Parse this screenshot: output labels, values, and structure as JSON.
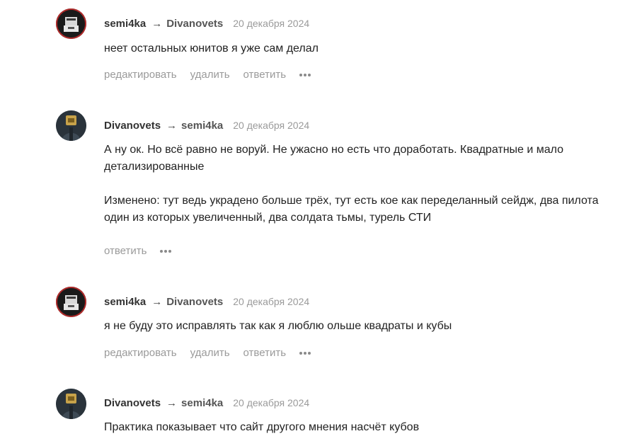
{
  "comments": [
    {
      "author": "semi4ka",
      "arrow": "→",
      "reply_to": "Divanovets",
      "date": "20 декабря 2024",
      "text": [
        "неет остальных юнитов я уже сам делал"
      ],
      "actions": [
        "редактировать",
        "удалить",
        "ответить"
      ],
      "avatar_icon": "robot-avatar-icon"
    },
    {
      "author": "Divanovets",
      "arrow": "→",
      "reply_to": "semi4ka",
      "date": "20 декабря 2024",
      "text": [
        "А ну ок. Но всё равно не воруй. Не ужасно но есть что доработать. Квадратные и мало детализированные",
        "Изменено: тут ведь украдено больше трёх, тут есть кое как переделанный сейдж, два пилота один из которых увеличенный, два солдата тьмы, турель СТИ"
      ],
      "actions": [
        "ответить"
      ],
      "avatar_icon": "person-avatar-icon"
    },
    {
      "author": "semi4ka",
      "arrow": "→",
      "reply_to": "Divanovets",
      "date": "20 декабря 2024",
      "text": [
        "я не буду это исправлять так как я люблю ольше квадраты и кубы"
      ],
      "actions": [
        "редактировать",
        "удалить",
        "ответить"
      ],
      "avatar_icon": "robot-avatar-icon"
    },
    {
      "author": "Divanovets",
      "arrow": "→",
      "reply_to": "semi4ka",
      "date": "20 декабря 2024",
      "text": [
        "Практика показывает что сайт другого мнения насчёт кубов"
      ],
      "actions": [],
      "avatar_icon": "person-avatar-icon"
    }
  ],
  "colors": {
    "text": "#222222",
    "muted": "#9a9a9a",
    "semi_avatar_ring": "#b22a2a"
  }
}
